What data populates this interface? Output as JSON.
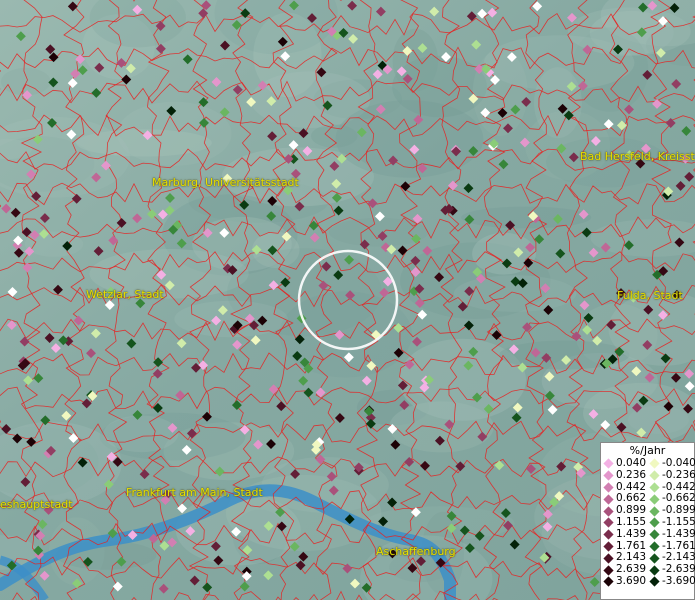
{
  "map": {
    "cities": [
      {
        "name": "Marburg, Universitätsstadt",
        "pos": [
          152,
          184
        ]
      },
      {
        "name": "Bad Hersfeld, Kreisstadt",
        "pos": [
          580,
          158
        ]
      },
      {
        "name": "Wetzlar, Stadt",
        "pos": [
          86,
          296
        ]
      },
      {
        "name": "Fulda, Stadt",
        "pos": [
          617,
          297
        ]
      },
      {
        "name": "Frankfurt am Main, Stadt",
        "pos": [
          126,
          494
        ]
      },
      {
        "name": "eshauptstadt",
        "pos": [
          0,
          506
        ]
      },
      {
        "name": "Aschaffenburg",
        "pos": [
          376,
          553
        ]
      }
    ],
    "colors": {
      "water": "#3c8fc8",
      "boundary": "#e82020",
      "label": "#e8e000"
    }
  },
  "legend": {
    "title": "%/Jahr",
    "positive": [
      {
        "label": "0.040",
        "color": "#f4b0e4"
      },
      {
        "label": "0.236",
        "color": "#e496cc"
      },
      {
        "label": "0.442",
        "color": "#d27fb2"
      },
      {
        "label": "0.662",
        "color": "#bf6796"
      },
      {
        "label": "0.899",
        "color": "#a9517b"
      },
      {
        "label": "1.155",
        "color": "#923e63"
      },
      {
        "label": "1.439",
        "color": "#7a2d4c"
      },
      {
        "label": "1.761",
        "color": "#631e37"
      },
      {
        "label": "2.143",
        "color": "#4b1124"
      },
      {
        "label": "2.639",
        "color": "#350813"
      },
      {
        "label": "3.690",
        "color": "#1c0206"
      }
    ],
    "negative": [
      {
        "label": "-0.040",
        "color": "#f0f8c0"
      },
      {
        "label": "-0.236",
        "color": "#d0ecaa"
      },
      {
        "label": "-0.442",
        "color": "#addf92"
      },
      {
        "label": "-0.662",
        "color": "#8acc78"
      },
      {
        "label": "-0.899",
        "color": "#6bb661"
      },
      {
        "label": "-1.155",
        "color": "#4e9e4c"
      },
      {
        "label": "-1.439",
        "color": "#37863a"
      },
      {
        "label": "-1.761",
        "color": "#236d2a"
      },
      {
        "label": "-2.143",
        "color": "#15541d"
      },
      {
        "label": "-2.639",
        "color": "#0a3b12"
      },
      {
        "label": "-3.690",
        "color": "#032108"
      }
    ]
  }
}
